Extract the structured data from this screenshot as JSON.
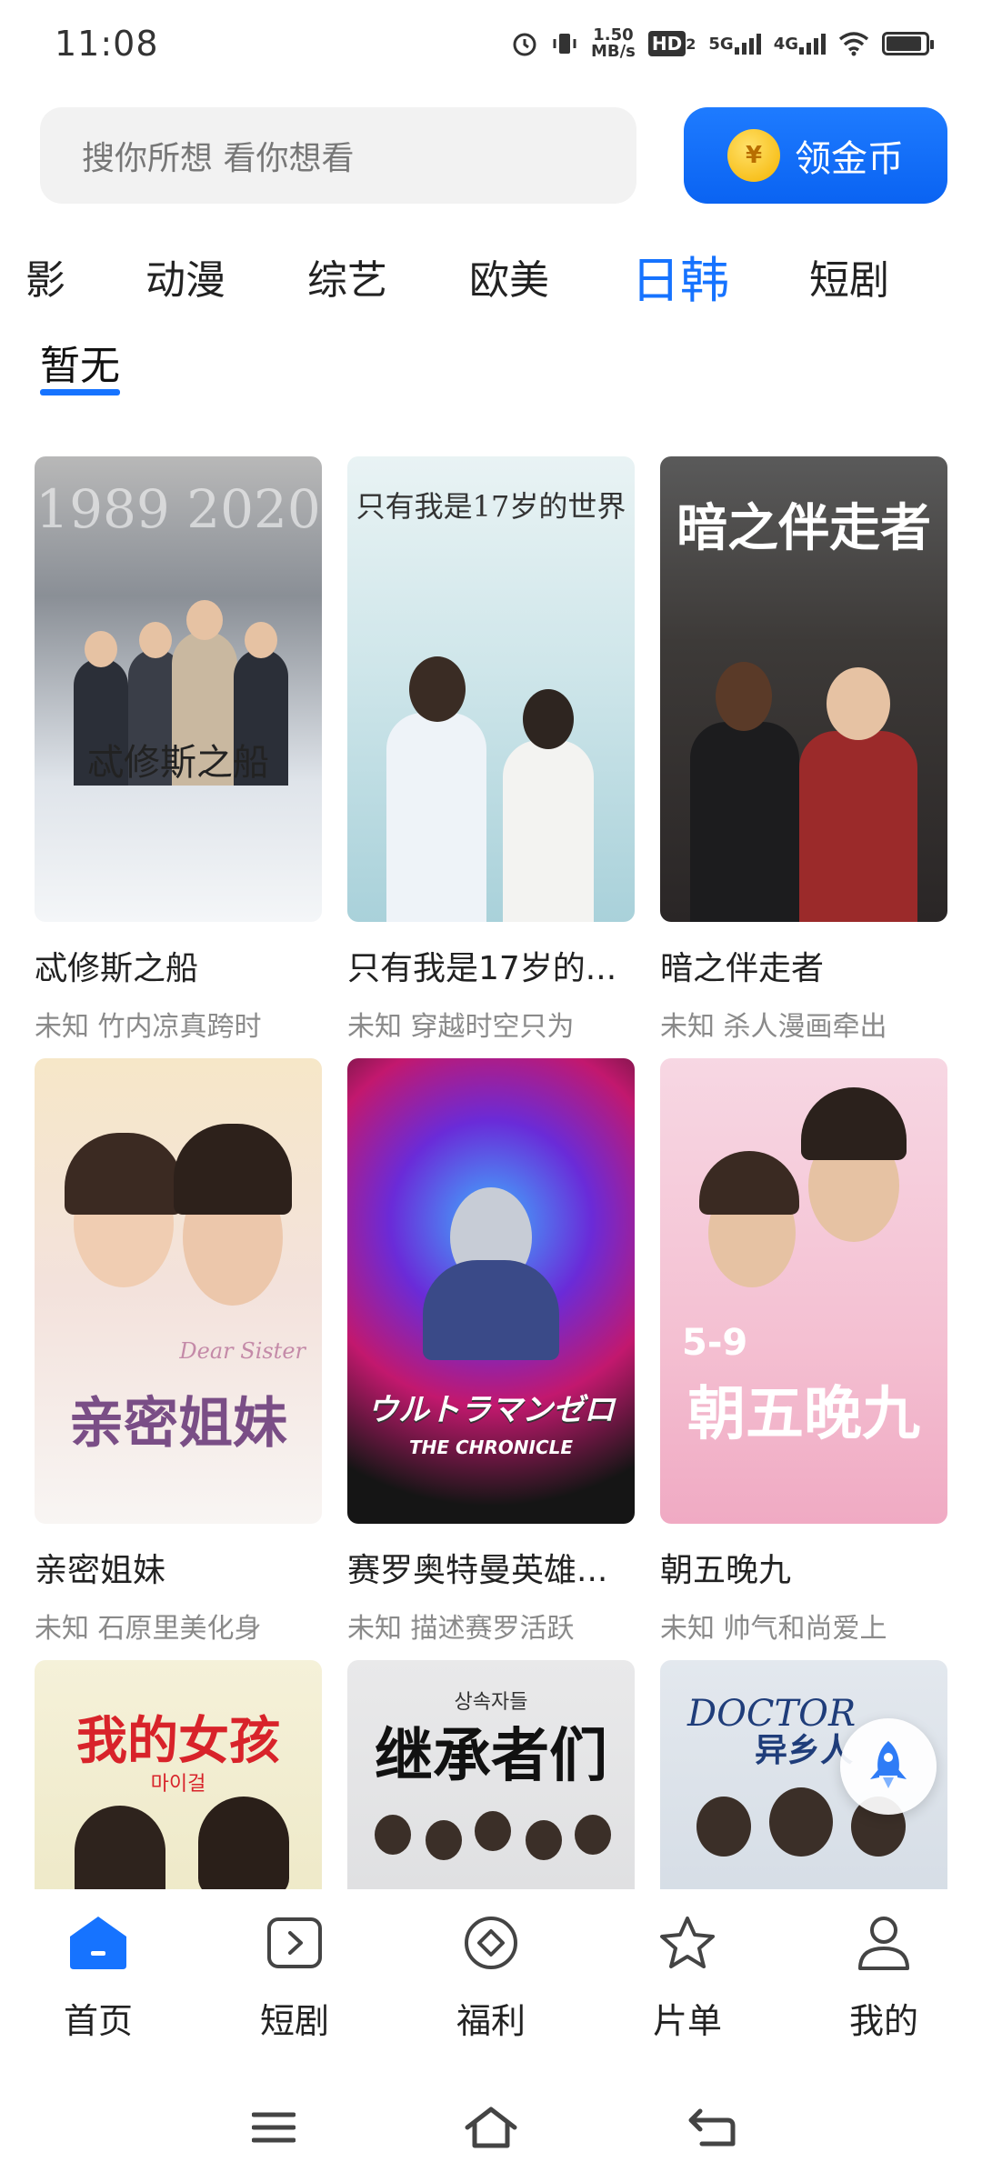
{
  "status_bar": {
    "time": "11:08",
    "net_speed_value": "1.50",
    "net_speed_unit": "MB/s",
    "hd_label": "HD",
    "hd_sub": "2",
    "sim1_label": "5G",
    "sim2_label": "4G"
  },
  "search": {
    "placeholder": "搜你所想 看你想看"
  },
  "coin_button": {
    "icon_symbol": "¥",
    "label": "领金币",
    "color": "#1673ff"
  },
  "category_tabs": [
    {
      "label": "影",
      "active": false
    },
    {
      "label": "动漫",
      "active": false
    },
    {
      "label": "综艺",
      "active": false
    },
    {
      "label": "欧美",
      "active": false
    },
    {
      "label": "日韩",
      "active": true
    },
    {
      "label": "短剧",
      "active": false
    }
  ],
  "sub_tab": {
    "label": "暂无"
  },
  "cards": [
    {
      "title": "忒修斯之船",
      "subtitle": "未知  竹内凉真跨时",
      "poster_text": "忒修斯之船",
      "poster_top": "1989  2020"
    },
    {
      "title": "只有我是17岁的...",
      "subtitle": "未知  穿越时空只为",
      "poster_text": "只有我是17岁的世界",
      "poster_top": ""
    },
    {
      "title": "暗之伴走者",
      "subtitle": "未知  杀人漫画牵出",
      "poster_text": "暗之伴走者",
      "poster_top": ""
    },
    {
      "title": "亲密姐妹",
      "subtitle": "未知  石原里美化身",
      "poster_text": "亲密姐妹",
      "poster_top": "Dear Sister"
    },
    {
      "title": "赛罗奥特曼英雄...",
      "subtitle": "未知  描述赛罗活跃",
      "poster_text": "ウルトラマンゼロ",
      "poster_top": "THE CHRONICLE"
    },
    {
      "title": "朝五晚九",
      "subtitle": "未知  帅气和尚爱上",
      "poster_text": "朝五晚九",
      "poster_top": "5-9"
    },
    {
      "title": "",
      "subtitle": "",
      "poster_text": "我的女孩",
      "poster_top": "마이걸"
    },
    {
      "title": "",
      "subtitle": "",
      "poster_text": "继承者们",
      "poster_top": "상속자들"
    },
    {
      "title": "",
      "subtitle": "",
      "poster_text": "异乡人",
      "poster_top": "DOCTOR"
    }
  ],
  "bottom_nav": [
    {
      "label": "首页",
      "active": true,
      "icon": "home-icon"
    },
    {
      "label": "短剧",
      "active": false,
      "icon": "short-drama-icon"
    },
    {
      "label": "福利",
      "active": false,
      "icon": "welfare-icon"
    },
    {
      "label": "片单",
      "active": false,
      "icon": "star-icon"
    },
    {
      "label": "我的",
      "active": false,
      "icon": "profile-icon"
    }
  ],
  "system_nav": {
    "menu_icon": "menu-icon",
    "home_icon": "system-home-icon",
    "back_icon": "back-icon"
  }
}
